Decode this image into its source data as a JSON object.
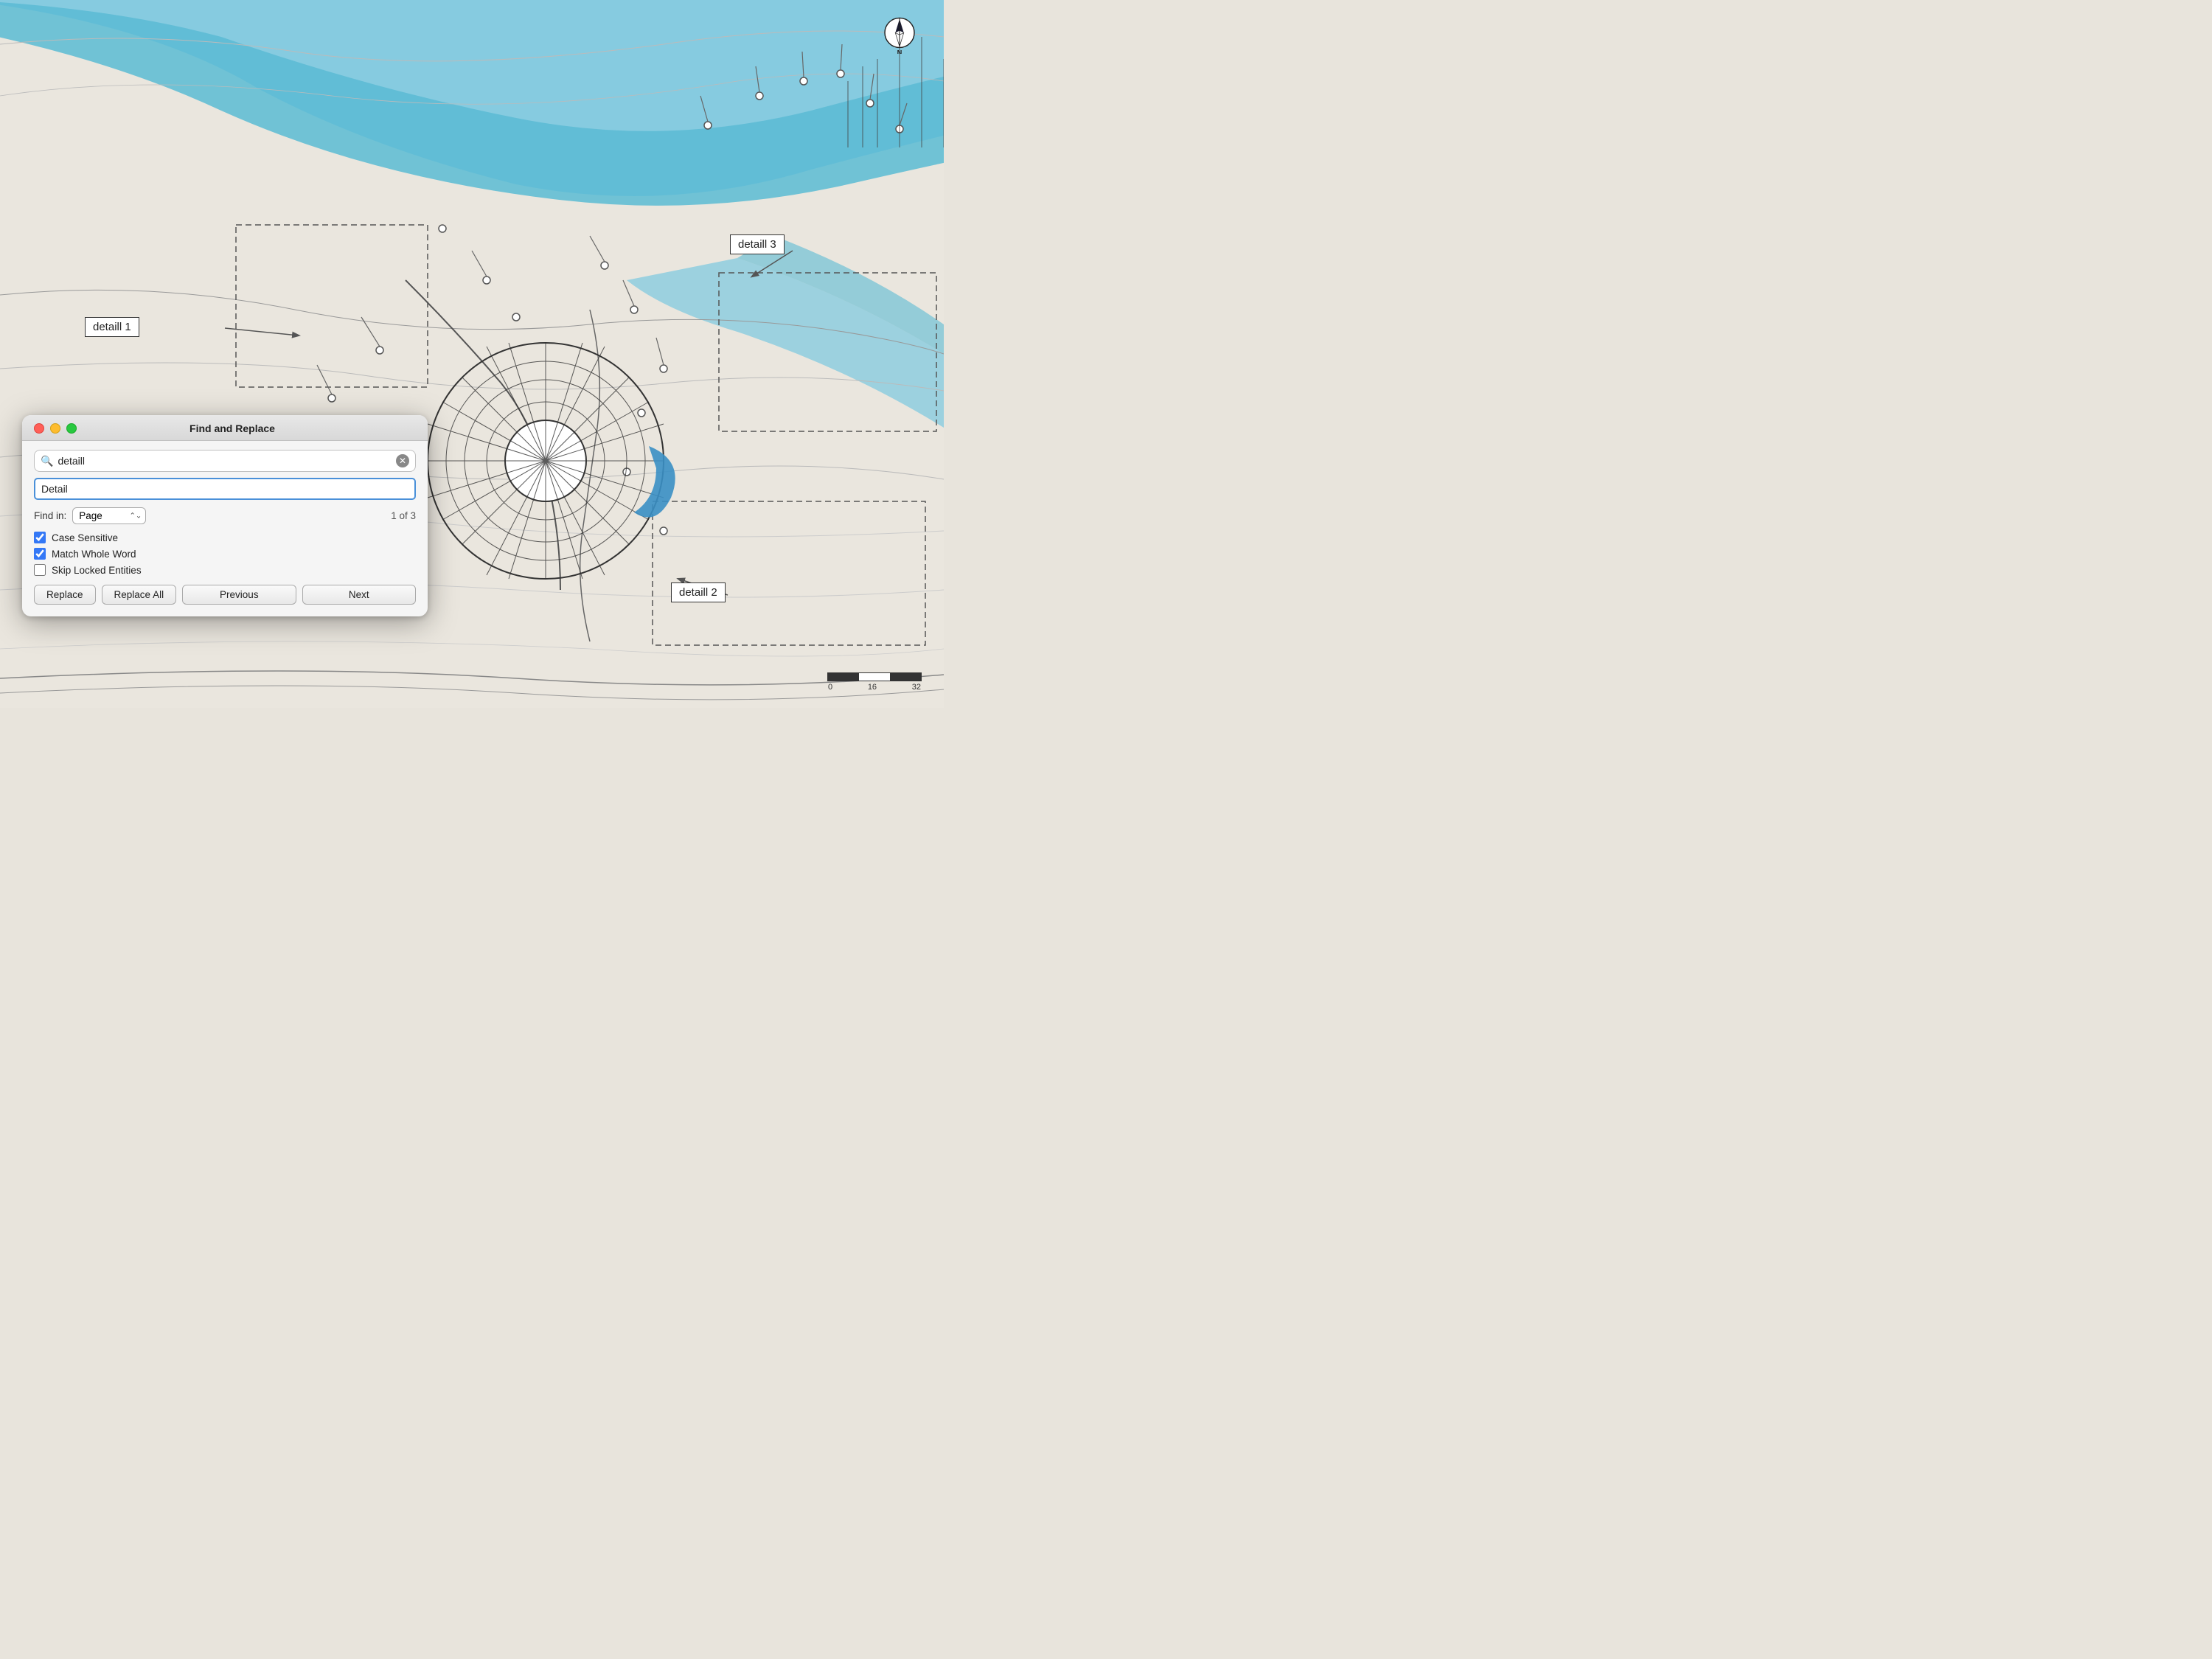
{
  "dialog": {
    "title": "Find and Replace",
    "search_value": "detaill",
    "replace_value": "Detail",
    "find_in_label": "Find in:",
    "find_in_value": "Page",
    "count_label": "1 of 3",
    "checkbox_case_sensitive": "Case Sensitive",
    "checkbox_match_whole_word": "Match Whole Word",
    "checkbox_skip_locked": "Skip Locked Entities",
    "btn_replace": "Replace",
    "btn_replace_all": "Replace All",
    "btn_previous": "Previous",
    "btn_next": "Next"
  },
  "map": {
    "detail1_label": "detaill 1",
    "detail2_label": "detaill 2",
    "detail3_label": "detaill 3",
    "scale_0": "0",
    "scale_16": "16",
    "scale_32": "32",
    "north_label": "N"
  }
}
